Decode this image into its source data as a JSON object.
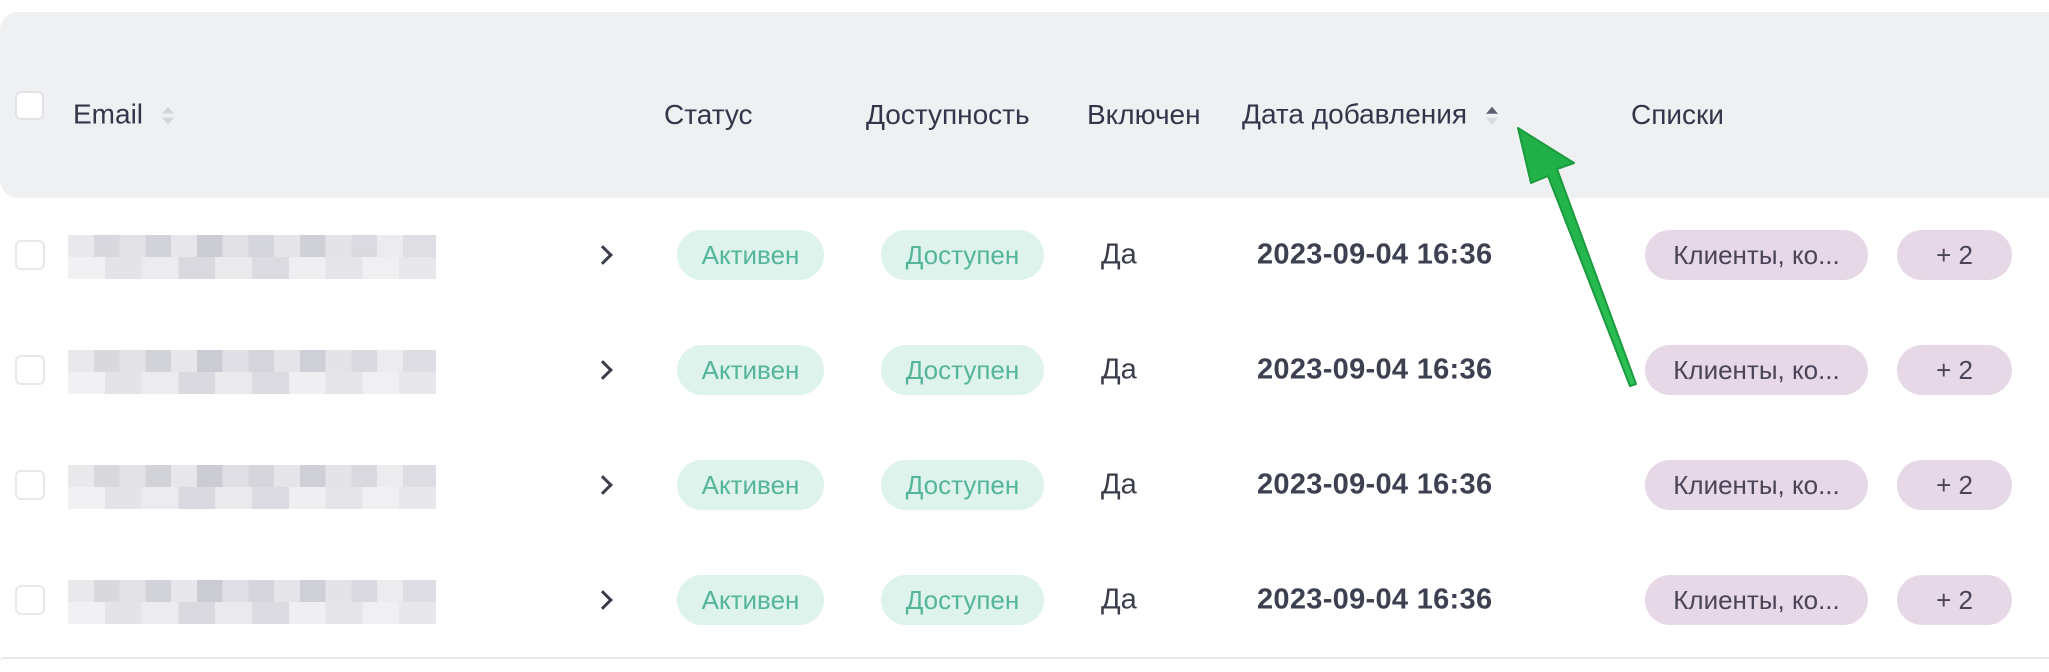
{
  "table": {
    "columns": {
      "email": "Email",
      "status": "Статус",
      "availability": "Доступность",
      "enabled": "Включен",
      "date_added": "Дата добавления",
      "lists": "Списки"
    },
    "rows": [
      {
        "status": "Активен",
        "availability": "Доступен",
        "enabled": "Да",
        "date_added": "2023-09-04 16:36",
        "lists": "Клиенты, ко...",
        "lists_more": "+ 2"
      },
      {
        "status": "Активен",
        "availability": "Доступен",
        "enabled": "Да",
        "date_added": "2023-09-04 16:36",
        "lists": "Клиенты, ко...",
        "lists_more": "+ 2"
      },
      {
        "status": "Активен",
        "availability": "Доступен",
        "enabled": "Да",
        "date_added": "2023-09-04 16:36",
        "lists": "Клиенты, ко...",
        "lists_more": "+ 2"
      },
      {
        "status": "Активен",
        "availability": "Доступен",
        "enabled": "Да",
        "date_added": "2023-09-04 16:36",
        "lists": "Клиенты, ко...",
        "lists_more": "+ 2"
      }
    ]
  },
  "colors": {
    "header_bg": "#eef0f2",
    "status_pill_bg": "#ddf3ec",
    "status_pill_text": "#55b59a",
    "list_pill_bg": "#e6d8e6",
    "annotation_arrow": "#22b14c"
  },
  "icons": {
    "email_sort": "sort-icon",
    "date_sort": "sort-ascending-icon",
    "row_expand": "chevron-right-icon",
    "annotation": "arrow-annotation-icon"
  }
}
